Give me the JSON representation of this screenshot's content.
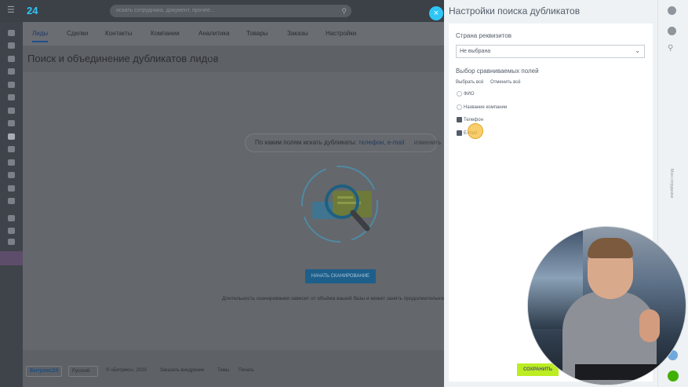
{
  "app": {
    "logo": "24",
    "search_placeholder": "искать сотрудника, документ, прочее...",
    "nav_tabs": [
      "Лиды",
      "Сделки",
      "Контакты",
      "Компании",
      "Аналитика",
      "Товары",
      "Заказы",
      "Настройки"
    ],
    "active_tab": "Лиды",
    "page_title": "Поиск и объединение дубликатов лидов",
    "duplicates_prompt": "По каким полям искать дубликаты:",
    "duplicates_fields": "телефон, e-mail",
    "duplicates_change": "изменить",
    "scan_button": "НАЧАТЬ СКАНИРОВАНИЕ",
    "scan_note": "Длительность сканирования зависит от объёма вашей базы и может занять продолжительное",
    "footer": {
      "brand": "Битрикс24",
      "language": "Русский",
      "copyright": "© «Битрикс», 2020",
      "order": "Заказать внедрение",
      "themes": "Темы",
      "print": "Печать"
    }
  },
  "panel": {
    "title": "Настройки поиска дубликатов",
    "country_label": "Страна реквизитов",
    "country_value": "Не выбрана",
    "fields_label": "Выбор сравниваемых полей",
    "select_all": "Выбрать всё",
    "deselect_all": "Отменить всё",
    "options": [
      {
        "label": "ФИО",
        "checked": false
      },
      {
        "label": "Название компании",
        "checked": false
      },
      {
        "label": "Телефон",
        "checked": true
      },
      {
        "label": "E-mail",
        "checked": true
      }
    ],
    "save_button": "СОХРАНИТЬ",
    "rail_text": "Мои сотрудники"
  },
  "colors": {
    "accent_cyan": "#2fc6f6",
    "save_green": "#bbed21",
    "text_gray": "#535c69",
    "scan_blue": "#1d5f8a"
  }
}
